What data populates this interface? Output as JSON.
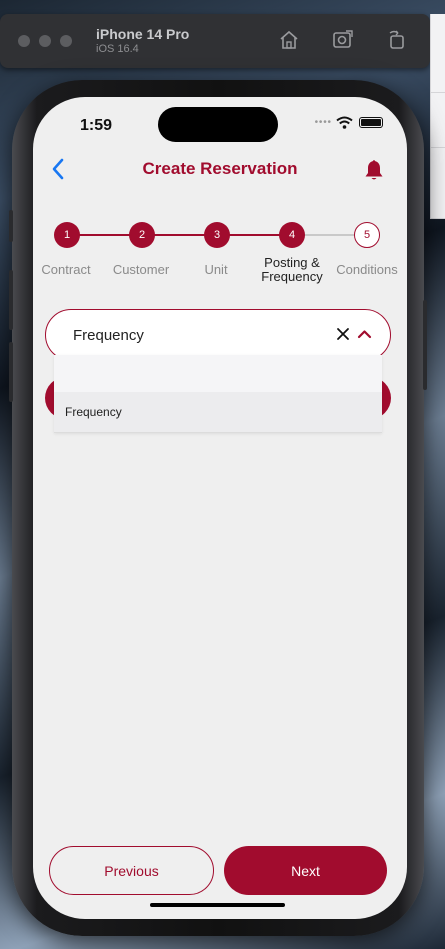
{
  "simulator": {
    "device_name": "iPhone 14 Pro",
    "os_version": "iOS 16.4",
    "icons": [
      "home-icon",
      "screenshot-icon",
      "rotate-icon"
    ]
  },
  "status_bar": {
    "time": "1:59"
  },
  "nav": {
    "title": "Create Reservation",
    "back_icon": "chevron-left-icon",
    "bell_icon": "bell-icon"
  },
  "stepper": {
    "steps": [
      {
        "number": "1",
        "label": "Contract",
        "state": "complete"
      },
      {
        "number": "2",
        "label": "Customer",
        "state": "complete"
      },
      {
        "number": "3",
        "label": "Unit",
        "state": "complete"
      },
      {
        "number": "4",
        "label": "Posting &\nFrequency",
        "state": "current"
      },
      {
        "number": "5",
        "label": "Conditions",
        "state": "upcoming"
      }
    ]
  },
  "frequency_dropdown": {
    "selected_label": "Frequency",
    "options": [
      "Frequency"
    ]
  },
  "buttons": {
    "previous": "Previous",
    "next": "Next"
  },
  "colors": {
    "accent": "#a10c2e",
    "screen_bg": "#efefef",
    "inactive_line": "#c9c9c9",
    "back_arrow": "#1877f2"
  }
}
